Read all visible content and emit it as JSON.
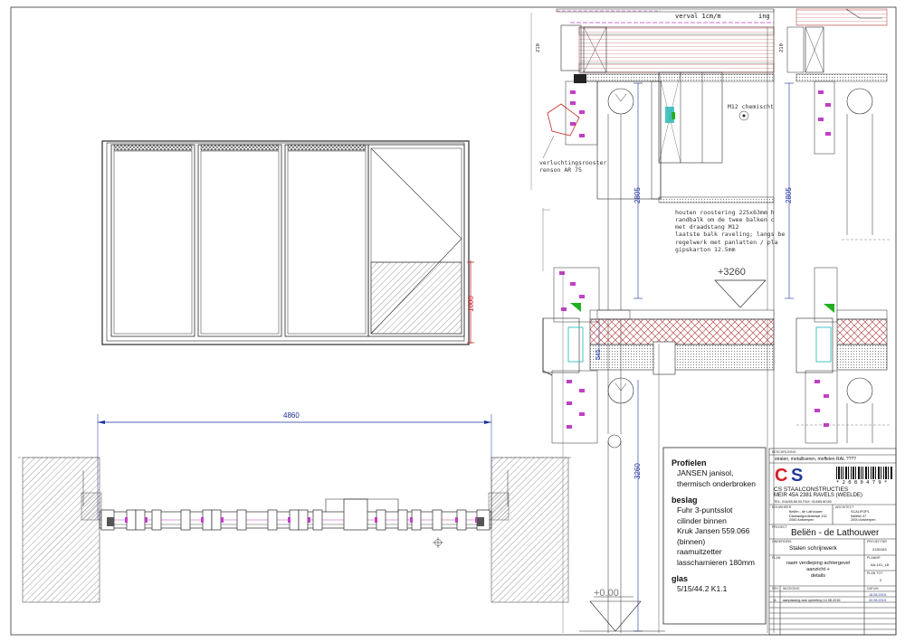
{
  "drawing": {
    "elevation": {
      "dim_width_label": "4860",
      "dim_sill_label": "1000"
    },
    "section_left": {
      "slope_text": "verval 1cm/m",
      "trunc_text": "ing",
      "dim_top_label": "210",
      "vent_label_line1": "verluchtingsrooster",
      "vent_label_line2": "renson AR 75",
      "anchor_label": "M12 chemischt",
      "dim_height_label": "2805",
      "wood_note_lines": [
        "houten roostering 225x63mm h",
        "randbalk om de twee balken c",
        "met draadstang M12",
        "laatste balk raveling; langs be",
        "regelwerk met panlatten / pla",
        "gipskarton 12.5mm"
      ],
      "level_upper": "+3260",
      "dim_mid_label": "545",
      "dim_lower_label": "3260",
      "level_zero": "+0.00"
    },
    "section_right": {
      "dim_top_label": "210",
      "dim_height_label": "2805"
    }
  },
  "notes": {
    "sections": [
      {
        "heading": "Profielen",
        "lines": [
          "JANSEN janisol,",
          "thermisch onderbroken"
        ]
      },
      {
        "heading": "beslag",
        "lines": [
          "Fuhr 3-puntsslot",
          "cilinder binnen",
          "Kruk Jansen 559.066",
          "(binnen)",
          "raamuitzetter",
          "lasscharnieren 180mm"
        ]
      },
      {
        "heading": "glas",
        "lines": [
          "5/15/44.2 K1.1"
        ]
      }
    ]
  },
  "titleblock": {
    "spec_label": "BESCHRIJVING",
    "spec": "stralen, metalliseren, moffelen RAL ????",
    "logo_c": "C",
    "logo_s": "S",
    "barcode_text": "* 2 0 8 0 4 7 9 *",
    "company": "CS STAALCONSTRUCTIES",
    "address": "MEIR 45A  2381 RAVELS (WEELDE)",
    "phone": "TEL: 014/65.80.00       FAX: 014/65.80.80",
    "client_label": "BOUWHEER",
    "client_lines": [
      "Beliën - de Lathouwer",
      "Diamantgordelstraat 132",
      "2060 Antwerpen"
    ],
    "architect_label": "ARCHITECT",
    "architect_lines": [
      "SCALIFOPL",
      "Italiëlei 47",
      "2000 Antwerpen"
    ],
    "project_label": "PROJECT",
    "project": "Beliën - de Lathouwer",
    "subject_label": "ONDERDEEL",
    "subject": "Stalen schrijnwerk",
    "projectnr_label": "PROJECTNR",
    "projectnr": "2150163",
    "plan_label": "PLAN",
    "plan_lines": [
      "raam verdieping achtergevel",
      "aanzicht +",
      "details"
    ],
    "plannr_label": "PLANNR",
    "plannr": "AA-101_18",
    "sheet_label": "PLAN TOT",
    "sheet": "2",
    "rev_label": "REV",
    "wijziging_label": "WIJZIGING",
    "datum_label": "DATUM",
    "rev_rows": [
      {
        "rev": "",
        "text": "",
        "date": "18.08.2015"
      },
      {
        "rev": "A",
        "text": "aanpassing aan opmeting 14.08.2015",
        "date": "20.08.2015"
      }
    ]
  },
  "colors": {
    "line": "#2a2a2a",
    "dimension": "#1b2f9c",
    "sill_dimension": "#c62828",
    "magenta": "#c23fc6",
    "insulation": "#b03030",
    "cyan": "#1fb5b5",
    "green": "#20b020",
    "logo_red": "#d81f26",
    "logo_blue": "#1f3c9a"
  }
}
